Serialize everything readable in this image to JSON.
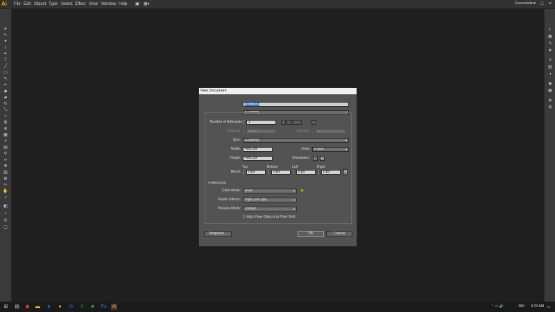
{
  "app": {
    "logo": "Ai"
  },
  "menu": [
    "File",
    "Edit",
    "Object",
    "Type",
    "Select",
    "Effect",
    "View",
    "Window",
    "Help"
  ],
  "workspace": "Essentials",
  "dialog": {
    "title": "New Document",
    "name_label": "Name:",
    "name_value": "Untitled-2",
    "profile_label": "Profile:",
    "profile_value": "[Custom]",
    "artboards_label": "Number of Artboards:",
    "artboards_value": "1",
    "spacing_label": "Spacing:",
    "spacing_value": "20 px",
    "columns_label": "Columns:",
    "columns_value": "1",
    "size_label": "Size:",
    "size_value": "[Custom]",
    "width_label": "Width:",
    "width_value": "4000 px",
    "units_label": "Units:",
    "units_value": "Pixels",
    "height_label": "Height:",
    "height_value": "4000 px",
    "orientation_label": "Orientation:",
    "bleed_label": "Bleed:",
    "bleed_headers": [
      "Top",
      "Bottom",
      "Left",
      "Right"
    ],
    "bleed_values": [
      "0 px",
      "0 px",
      "0 px",
      "0 px"
    ],
    "advanced_label": "Advanced",
    "color_mode_label": "Color Mode:",
    "color_mode_value": "RGB",
    "raster_label": "Raster Effects:",
    "raster_value": "High (300 ppi)",
    "preview_label": "Preview Mode:",
    "preview_value": "Default",
    "align_label": "Align New Objects to Pixel Grid",
    "templates_button": "Templates...",
    "ok_button": "OK",
    "cancel_button": "Cancel"
  },
  "taskbar": {
    "lang": "IND",
    "time": "5:23 AM"
  },
  "colors": {
    "accent": "#ff9a00",
    "warning": "#e8c400",
    "selection": "#3d78d8"
  }
}
